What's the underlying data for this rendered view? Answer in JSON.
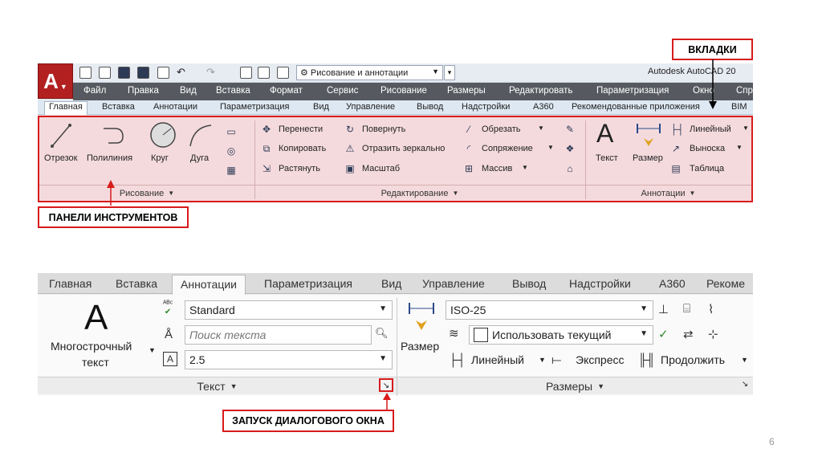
{
  "top": {
    "app_button": "A",
    "workspace": "Рисование и аннотации",
    "app_title": "Autodesk AutoCAD 20",
    "menu": [
      "Файл",
      "Правка",
      "Вид",
      "Вставка",
      "Формат",
      "Сервис",
      "Рисование",
      "Размеры",
      "Редактировать",
      "Параметризация",
      "Окно",
      "Спр"
    ],
    "tabs": [
      "Главная",
      "Вставка",
      "Аннотации",
      "Параметризация",
      "Вид",
      "Управление",
      "Вывод",
      "Надстройки",
      "А360",
      "Рекомендованные приложения",
      "BIM"
    ],
    "draw": {
      "tools": [
        "Отрезок",
        "Полилиния",
        "Круг",
        "Дуга"
      ],
      "footer": "Рисование"
    },
    "modify": {
      "col1": [
        "Перенести",
        "Копировать",
        "Растянуть"
      ],
      "col2": [
        "Повернуть",
        "Отразить зеркально",
        "Масштаб"
      ],
      "col3": [
        "Обрезать",
        "Сопряжение",
        "Массив"
      ],
      "footer": "Редактирование"
    },
    "annotation": {
      "text": "Текст",
      "dimension": "Размер",
      "items": [
        "Линейный",
        "Выноска",
        "Таблица"
      ],
      "footer": "Аннотации"
    }
  },
  "bottom": {
    "tabs": [
      "Главная",
      "Вставка",
      "Аннотации",
      "Параметризация",
      "Вид",
      "Управление",
      "Вывод",
      "Надстройки",
      "А360",
      "Рекоме"
    ],
    "text_panel": {
      "big_letter": "A",
      "mtext_line1": "Многострочный",
      "mtext_line2": "текст",
      "style": "Standard",
      "search_placeholder": "Поиск текста",
      "height": "2.5",
      "footer": "Текст"
    },
    "dim_panel": {
      "dimension": "Размер",
      "style": "ISO-25",
      "layer": "Использовать текущий",
      "linear": "Линейный",
      "express": "Экспресс",
      "continue": "Продолжить",
      "footer": "Размеры"
    }
  },
  "callouts": {
    "tabs": "ВКЛАДКИ",
    "panels": "ПАНЕЛИ ИНСТРУМЕНТОВ",
    "dialog": "ЗАПУСК ДИАЛОГОВОГО ОКНА"
  },
  "page_number": "6",
  "colors": {
    "callout_red": "#d81b1b",
    "panel_highlight": "#f4dadd",
    "menubar": "#565a60"
  }
}
